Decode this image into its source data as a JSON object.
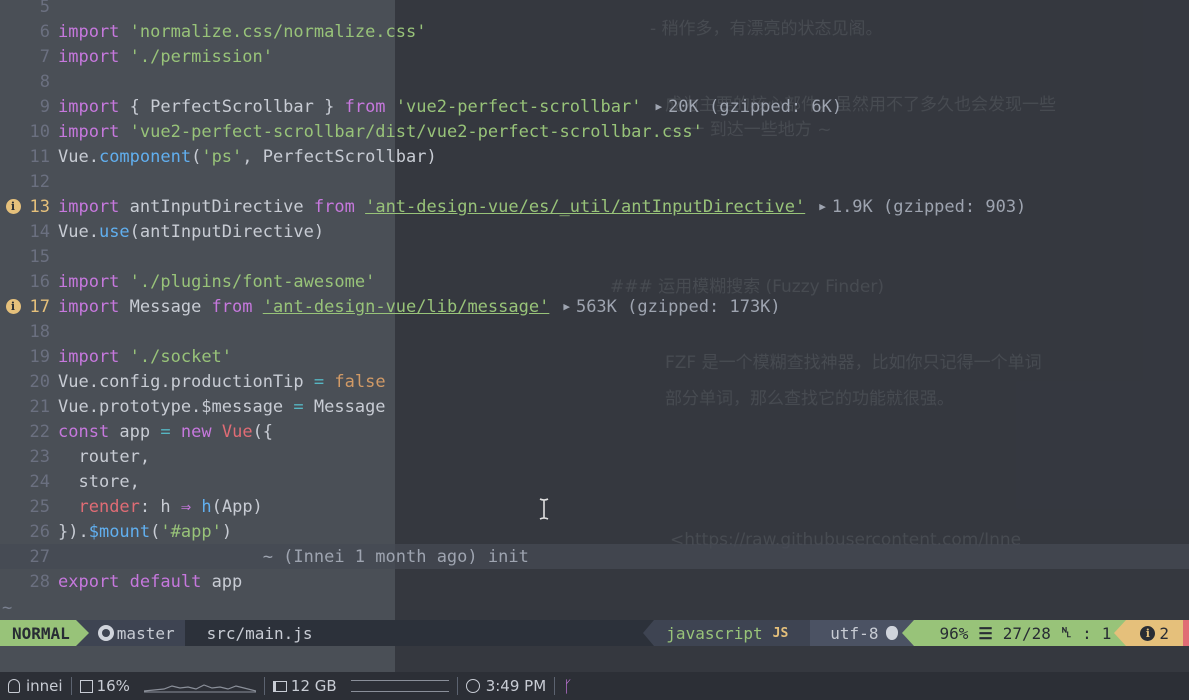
{
  "editor": {
    "lines": [
      {
        "n": "5",
        "tokens": []
      },
      {
        "n": "6",
        "tokens": [
          [
            "kw",
            "import"
          ],
          [
            "plain",
            " "
          ],
          [
            "str",
            "'normalize.css/normalize.css'"
          ]
        ]
      },
      {
        "n": "7",
        "tokens": [
          [
            "kw",
            "import"
          ],
          [
            "plain",
            " "
          ],
          [
            "str",
            "'./permission'"
          ]
        ]
      },
      {
        "n": "8",
        "tokens": []
      },
      {
        "n": "9",
        "tokens": [
          [
            "kw",
            "import"
          ],
          [
            "plain",
            " { PerfectScrollbar } "
          ],
          [
            "kw",
            "from"
          ],
          [
            "plain",
            " "
          ],
          [
            "str",
            "'vue2-perfect-scrollbar'"
          ]
        ],
        "virtual": "20K (gzipped: 6K)"
      },
      {
        "n": "10",
        "tokens": [
          [
            "kw",
            "import"
          ],
          [
            "plain",
            " "
          ],
          [
            "str",
            "'vue2-perfect-scrollbar/dist/vue2-perfect-scrollbar.css'"
          ]
        ]
      },
      {
        "n": "11",
        "tokens": [
          [
            "plain",
            "Vue."
          ],
          [
            "fn",
            "component"
          ],
          [
            "plain",
            "("
          ],
          [
            "str",
            "'ps'"
          ],
          [
            "plain",
            ", PerfectScrollbar)"
          ]
        ]
      },
      {
        "n": "12",
        "tokens": []
      },
      {
        "n": "13",
        "sign": "info",
        "tokens": [
          [
            "kw",
            "import"
          ],
          [
            "plain",
            " antInputDirective "
          ],
          [
            "kw",
            "from"
          ],
          [
            "plain",
            " "
          ],
          [
            "str-u",
            "'ant-design-vue/es/_util/antInputDirective'"
          ]
        ],
        "virtual": "1.9K (gzipped: 903)"
      },
      {
        "n": "14",
        "tokens": [
          [
            "plain",
            "Vue."
          ],
          [
            "fn",
            "use"
          ],
          [
            "plain",
            "(antInputDirective)"
          ]
        ]
      },
      {
        "n": "15",
        "tokens": []
      },
      {
        "n": "16",
        "tokens": [
          [
            "kw",
            "import"
          ],
          [
            "plain",
            " "
          ],
          [
            "str",
            "'./plugins/font-awesome'"
          ]
        ]
      },
      {
        "n": "17",
        "sign": "info",
        "tokens": [
          [
            "kw",
            "import"
          ],
          [
            "plain",
            " Message "
          ],
          [
            "kw",
            "from"
          ],
          [
            "plain",
            " "
          ],
          [
            "str-u",
            "'ant-design-vue/lib/message'"
          ]
        ],
        "virtual": "563K (gzipped: 173K)"
      },
      {
        "n": "18",
        "tokens": []
      },
      {
        "n": "19",
        "tokens": [
          [
            "kw",
            "import"
          ],
          [
            "plain",
            " "
          ],
          [
            "str",
            "'./socket'"
          ]
        ]
      },
      {
        "n": "20",
        "tokens": [
          [
            "plain",
            "Vue.config.productionTip "
          ],
          [
            "op",
            "="
          ],
          [
            "plain",
            " "
          ],
          [
            "bool",
            "false"
          ]
        ]
      },
      {
        "n": "21",
        "tokens": [
          [
            "plain",
            "Vue.prototype.$message "
          ],
          [
            "op",
            "="
          ],
          [
            "plain",
            " Message"
          ]
        ]
      },
      {
        "n": "22",
        "tokens": [
          [
            "kw",
            "const"
          ],
          [
            "plain",
            " app "
          ],
          [
            "op",
            "="
          ],
          [
            "plain",
            " "
          ],
          [
            "kw",
            "new"
          ],
          [
            "plain",
            " "
          ],
          [
            "prop",
            "Vue"
          ],
          [
            "plain",
            "({"
          ]
        ]
      },
      {
        "n": "23",
        "tokens": [
          [
            "plain",
            "  router,"
          ]
        ]
      },
      {
        "n": "24",
        "tokens": [
          [
            "plain",
            "  store,"
          ]
        ]
      },
      {
        "n": "25",
        "tokens": [
          [
            "plain",
            "  "
          ],
          [
            "prop",
            "render"
          ],
          [
            "plain",
            ": h "
          ],
          [
            "kw",
            "⇒"
          ],
          [
            "plain",
            " "
          ],
          [
            "fn",
            "h"
          ],
          [
            "plain",
            "(App)"
          ]
        ]
      },
      {
        "n": "26",
        "tokens": [
          [
            "plain",
            "})."
          ],
          [
            "fn",
            "$mount"
          ],
          [
            "plain",
            "("
          ],
          [
            "str",
            "'#app'"
          ],
          [
            "plain",
            ")"
          ]
        ]
      },
      {
        "n": "27",
        "current": true,
        "tokens": [
          [
            "virt",
            "                    ~ (Innei 1 month ago) init"
          ]
        ]
      },
      {
        "n": "28",
        "tokens": [
          [
            "kw",
            "export"
          ],
          [
            "plain",
            " "
          ],
          [
            "kw",
            "default"
          ],
          [
            "plain",
            " app"
          ]
        ]
      }
    ],
    "eof_marker": "~"
  },
  "statusline": {
    "mode": "NORMAL",
    "branch": "master",
    "file": "src/main.js",
    "filetype": "javascript",
    "filetype_badge": "JS",
    "encoding": "utf-8",
    "percent": "96%",
    "position": "27/28",
    "column": "1",
    "diagnostics": "2"
  },
  "tmux": {
    "user": "innei",
    "cpu": "16%",
    "memory": "12 GB",
    "time": "3:49 PM"
  },
  "ghost": {
    "lines": [
      "- 稍作多，有漂亮的状态见阁。",
      "成为主要的核心部件，虽然用不了多久也会发现一些",
      "— 一 到达一些地方 ~",
      "### 运用模糊搜索 (Fuzzy Finder)",
      "FZF 是一个模糊查找神器，比如你只记得一个单词",
      "部分单词，那么查找它的功能就很强。",
      "<https://raw.githubusercontent.com/Inne"
    ]
  },
  "colors": {
    "keyword": "#c678dd",
    "string": "#98c379",
    "function": "#61afef",
    "property": "#e06c75",
    "warning": "#e5c07b",
    "mode_bg": "#98c379"
  }
}
